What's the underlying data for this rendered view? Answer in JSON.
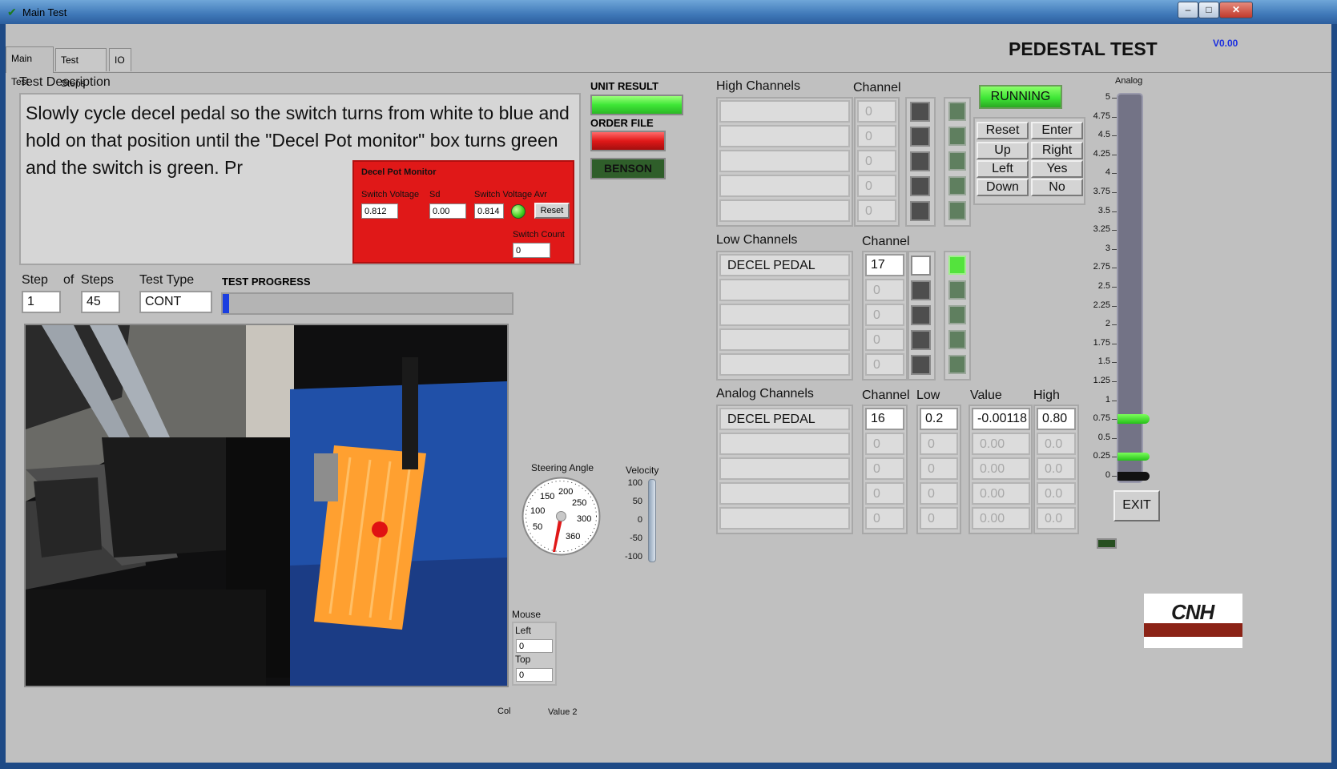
{
  "window": {
    "title": "Main Test",
    "close_label": "✕",
    "min_label": "–",
    "max_label": "□"
  },
  "tabs": [
    "Main Test",
    "Test Steps",
    "IO"
  ],
  "header": {
    "title": "PEDESTAL TEST",
    "version": "V0.00"
  },
  "test_description": {
    "label": "Test Description",
    "text": "Slowly cycle decel pedal so the switch turns from white to blue and hold on that position until the \"Decel Pot monitor\" box turns green and the switch is green. Pr"
  },
  "decel_monitor": {
    "title": "Decel Pot Monitor",
    "switch_voltage_label": "Switch Voltage",
    "switch_voltage": "0.812",
    "sd_label": "Sd",
    "sd": "0.00",
    "switch_voltage_avr_label": "Switch Voltage Avr",
    "switch_voltage_avr": "0.814",
    "reset_label": "Reset",
    "switch_count_label": "Switch Count",
    "switch_count": "0"
  },
  "step": {
    "step_label": "Step",
    "of_label": "of",
    "steps_label": "Steps",
    "step_value": "1",
    "steps_value": "45",
    "test_type_label": "Test Type",
    "test_type": "CONT",
    "progress_label": "TEST PROGRESS",
    "progress_fraction": 0.022
  },
  "results": {
    "unit_result_label": "UNIT RESULT",
    "order_file_label": "ORDER FILE",
    "benson_label": "BENSON"
  },
  "high_channels": {
    "label": "High Channels",
    "channel_label": "Channel",
    "rows": [
      {
        "name": "",
        "channel": "0",
        "square": "dark",
        "led": "off"
      },
      {
        "name": "",
        "channel": "0",
        "square": "dark",
        "led": "off"
      },
      {
        "name": "",
        "channel": "0",
        "square": "dark",
        "led": "off"
      },
      {
        "name": "",
        "channel": "0",
        "square": "dark",
        "led": "off"
      },
      {
        "name": "",
        "channel": "0",
        "square": "dark",
        "led": "off"
      }
    ]
  },
  "low_channels": {
    "label": "Low Channels",
    "channel_label": "Channel",
    "rows": [
      {
        "name": "DECEL PEDAL",
        "channel": "17",
        "square": "white",
        "led": "on"
      },
      {
        "name": "",
        "channel": "0",
        "square": "dark",
        "led": "off"
      },
      {
        "name": "",
        "channel": "0",
        "square": "dark",
        "led": "off"
      },
      {
        "name": "",
        "channel": "0",
        "square": "dark",
        "led": "off"
      },
      {
        "name": "",
        "channel": "0",
        "square": "dark",
        "led": "off"
      }
    ]
  },
  "analog_channels": {
    "label": "Analog Channels",
    "channel_label": "Channel",
    "low_label": "Low",
    "value_label": "Value",
    "high_label": "High",
    "rows": [
      {
        "name": "DECEL PEDAL",
        "channel": "16",
        "low": "0.2",
        "value": "-0.00118",
        "high": "0.80"
      },
      {
        "name": "",
        "channel": "0",
        "low": "0",
        "value": "0.00",
        "high": "0.0"
      },
      {
        "name": "",
        "channel": "0",
        "low": "0",
        "value": "0.00",
        "high": "0.0"
      },
      {
        "name": "",
        "channel": "0",
        "low": "0",
        "value": "0.00",
        "high": "0.0"
      },
      {
        "name": "",
        "channel": "0",
        "low": "0",
        "value": "0.00",
        "high": "0.0"
      }
    ]
  },
  "status": {
    "running_label": "RUNNING"
  },
  "keypad": [
    "Reset",
    "Enter",
    "Up",
    "Right",
    "Left",
    "Yes",
    "Down",
    "No"
  ],
  "analog_gauge": {
    "label": "Analog",
    "ticks": [
      "5",
      "4.75",
      "4.5",
      "4.25",
      "4",
      "3.75",
      "3.5",
      "3.25",
      "3",
      "2.75",
      "2.5",
      "2.25",
      "2",
      "1.75",
      "1.5",
      "1.25",
      "1",
      "0.75",
      "0.5",
      "0.25",
      "0"
    ],
    "high_marker": 0.75,
    "low_marker": 0.25,
    "value_marker": 0
  },
  "exit_label": "EXIT",
  "steering": {
    "label": "Steering Angle",
    "ticks": [
      "50",
      "100",
      "150",
      "200",
      "250",
      "300",
      "360"
    ]
  },
  "velocity": {
    "label": "Velocity",
    "ticks": [
      "100",
      "50",
      "0",
      "-50",
      "-100"
    ]
  },
  "mouse": {
    "label": "Mouse",
    "left_label": "Left",
    "left_value": "0",
    "top_label": "Top",
    "top_value": "0"
  },
  "footer": {
    "col_label": "Col",
    "value2_label": "Value 2"
  },
  "logo": {
    "text": "CNH"
  },
  "colors": {
    "panel": "#c0c0c0",
    "monitor_red": "#e01818",
    "led_green": "#54e33d",
    "progress_blue": "#1a3ee0",
    "running_green": "#3ee636"
  }
}
